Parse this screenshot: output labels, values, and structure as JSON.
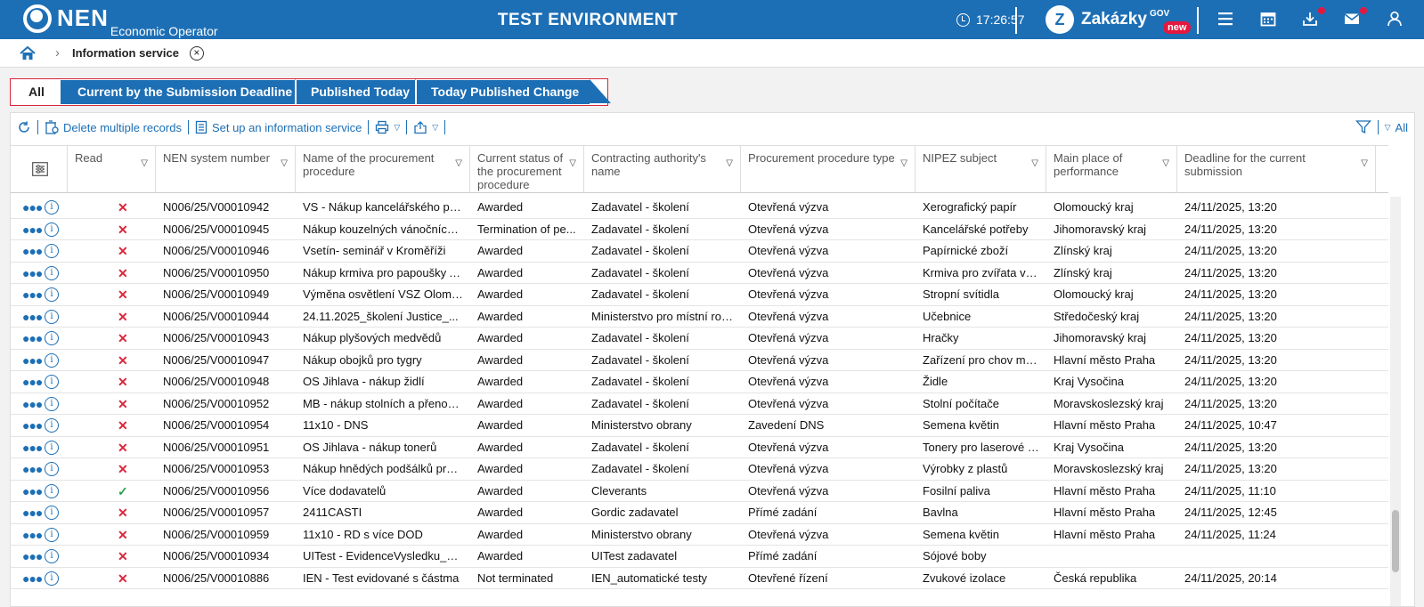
{
  "header": {
    "logo_text": "NEN",
    "logo_sub": "Economic Operator",
    "env_title": "TEST ENVIRONMENT",
    "time": "17:26:57",
    "brand": "Zakázky",
    "brand_sup": "GOV",
    "brand_badge": "new",
    "icons": [
      "menu-icon",
      "calendar-icon",
      "download-icon",
      "mail-icon",
      "user-icon"
    ],
    "brand_color": "#1d6fb5"
  },
  "breadcrumb": {
    "label": "Information service"
  },
  "tabs": [
    "All",
    "Current by the Submission Deadline",
    "Published Today",
    "Today Published Change"
  ],
  "toolbar": {
    "delete_label": "Delete multiple records",
    "setup_label": "Set up an information service",
    "filter_label": "All"
  },
  "columns": [
    "Read",
    "NEN system number",
    "Name of the procurement procedure",
    "Current status of the procurement procedure",
    "Contracting authority's name",
    "Procurement procedure type",
    "NIPEZ subject",
    "Main place of performance",
    "Deadline for the current submission"
  ],
  "rows": [
    {
      "read": false,
      "nen": "N006/25/V00010942",
      "name": "VS - Nákup kancelářského pa...",
      "status": "Awarded",
      "authority": "Zadavatel - školení",
      "type": "Otevřená výzva",
      "subject": "Xerografický papír",
      "place": "Olomoucký kraj",
      "deadline": "24/11/2025, 13:20"
    },
    {
      "read": false,
      "nen": "N006/25/V00010945",
      "name": "Nákup kouzelných vánočních ...",
      "status": "Termination of pe...",
      "authority": "Zadavatel - školení",
      "type": "Otevřená výzva",
      "subject": "Kancelářské potřeby",
      "place": "Jihomoravský kraj",
      "deadline": "24/11/2025, 13:20"
    },
    {
      "read": false,
      "nen": "N006/25/V00010946",
      "name": "Vsetín- seminář v Kroměříži",
      "status": "Awarded",
      "authority": "Zadavatel - školení",
      "type": "Otevřená výzva",
      "subject": "Papírnické zboží",
      "place": "Zlínský kraj",
      "deadline": "24/11/2025, 13:20"
    },
    {
      "read": false,
      "nen": "N006/25/V00010950",
      "name": "Nákup krmiva pro papoušky A...",
      "status": "Awarded",
      "authority": "Zadavatel - školení",
      "type": "Otevřená výzva",
      "subject": "Krmiva pro zvířata v z...",
      "place": "Zlínský kraj",
      "deadline": "24/11/2025, 13:20"
    },
    {
      "read": false,
      "nen": "N006/25/V00010949",
      "name": "Výměna osvětlení VSZ Olomo...",
      "status": "Awarded",
      "authority": "Zadavatel - školení",
      "type": "Otevřená výzva",
      "subject": "Stropní svítidla",
      "place": "Olomoucký kraj",
      "deadline": "24/11/2025, 13:20"
    },
    {
      "read": false,
      "nen": "N006/25/V00010944",
      "name": "24.11.2025_školení Justice_...",
      "status": "Awarded",
      "authority": "Ministerstvo pro místní roz...",
      "type": "Otevřená výzva",
      "subject": "Učebnice",
      "place": "Středočeský kraj",
      "deadline": "24/11/2025, 13:20"
    },
    {
      "read": false,
      "nen": "N006/25/V00010943",
      "name": "Nákup plyšových medvědů",
      "status": "Awarded",
      "authority": "Zadavatel - školení",
      "type": "Otevřená výzva",
      "subject": "Hračky",
      "place": "Jihomoravský kraj",
      "deadline": "24/11/2025, 13:20"
    },
    {
      "read": false,
      "nen": "N006/25/V00010947",
      "name": "Nákup obojků pro tygry",
      "status": "Awarded",
      "authority": "Zadavatel - školení",
      "type": "Otevřená výzva",
      "subject": "Zařízení pro chov mlá...",
      "place": "Hlavní město Praha",
      "deadline": "24/11/2025, 13:20"
    },
    {
      "read": false,
      "nen": "N006/25/V00010948",
      "name": "OS Jihlava - nákup židlí",
      "status": "Awarded",
      "authority": "Zadavatel - školení",
      "type": "Otevřená výzva",
      "subject": "Židle",
      "place": "Kraj Vysočina",
      "deadline": "24/11/2025, 13:20"
    },
    {
      "read": false,
      "nen": "N006/25/V00010952",
      "name": "MB - nákup stolních a přenosn...",
      "status": "Awarded",
      "authority": "Zadavatel - školení",
      "type": "Otevřená výzva",
      "subject": "Stolní počítače",
      "place": "Moravskoslezský kraj",
      "deadline": "24/11/2025, 13:20"
    },
    {
      "read": false,
      "nen": "N006/25/V00010954",
      "name": "11x10 - DNS",
      "status": "Awarded",
      "authority": "Ministerstvo obrany",
      "type": "Zavedení DNS",
      "subject": "Semena květin",
      "place": "Hlavní město Praha",
      "deadline": "24/11/2025, 10:47"
    },
    {
      "read": false,
      "nen": "N006/25/V00010951",
      "name": "OS Jihlava - nákup tonerů",
      "status": "Awarded",
      "authority": "Zadavatel - školení",
      "type": "Otevřená výzva",
      "subject": "Tonery pro laserové ti...",
      "place": "Kraj Vysočina",
      "deadline": "24/11/2025, 13:20"
    },
    {
      "read": false,
      "nen": "N006/25/V00010953",
      "name": "Nákup hnědých podšálků pro ...",
      "status": "Awarded",
      "authority": "Zadavatel - školení",
      "type": "Otevřená výzva",
      "subject": "Výrobky z plastů",
      "place": "Moravskoslezský kraj",
      "deadline": "24/11/2025, 13:20"
    },
    {
      "read": true,
      "nen": "N006/25/V00010956",
      "name": "Více dodavatelů",
      "status": "Awarded",
      "authority": "Cleverants",
      "type": "Otevřená výzva",
      "subject": "Fosilní paliva",
      "place": "Hlavní město Praha",
      "deadline": "24/11/2025, 11:10"
    },
    {
      "read": false,
      "nen": "N006/25/V00010957",
      "name": "2411CASTI",
      "status": "Awarded",
      "authority": "Gordic zadavatel",
      "type": "Přímé zadání",
      "subject": "Bavlna",
      "place": "Hlavní město Praha",
      "deadline": "24/11/2025, 12:45"
    },
    {
      "read": false,
      "nen": "N006/25/V00010959",
      "name": "11x10 - RD s více DOD",
      "status": "Awarded",
      "authority": "Ministerstvo obrany",
      "type": "Otevřená výzva",
      "subject": "Semena květin",
      "place": "Hlavní město Praha",
      "deadline": "24/11/2025, 11:24"
    },
    {
      "read": false,
      "nen": "N006/25/V00010934",
      "name": "UITest - EvidenceVysledku_1 - ...",
      "status": "Awarded",
      "authority": "UITest zadavatel",
      "type": "Přímé zadání",
      "subject": "Sójové boby",
      "place": "",
      "deadline": ""
    },
    {
      "read": false,
      "nen": "N006/25/V00010886",
      "name": "IEN - Test evidované s částma",
      "status": "Not terminated",
      "authority": "IEN_automatické testy",
      "type": "Otevřené řízení",
      "subject": "Zvukové izolace",
      "place": "Česká republika",
      "deadline": "24/11/2025, 20:14"
    }
  ]
}
